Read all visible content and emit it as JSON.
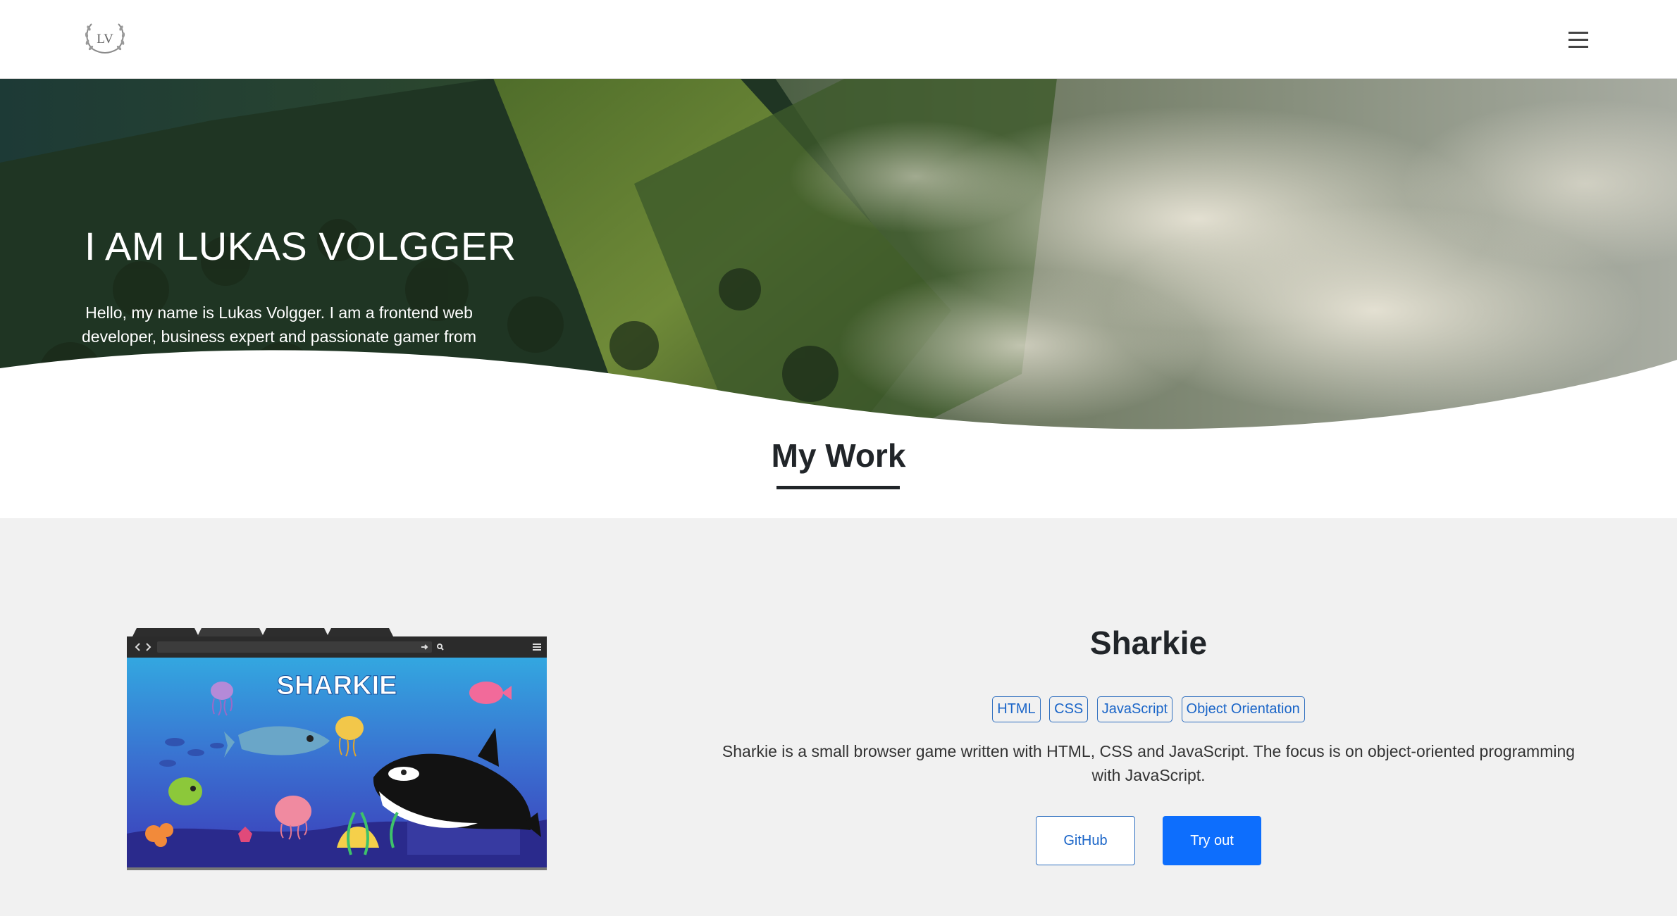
{
  "header": {
    "logo_text": "LV",
    "menu_icon": "hamburger-menu-icon"
  },
  "hero": {
    "title": "I AM LUKAS VOLGGER",
    "text": "Hello, my name is Lukas Volgger. I am a frontend web developer, business expert and passionate gamer from Austria."
  },
  "section": {
    "title": "My Work"
  },
  "project": {
    "title": "Sharkie",
    "image_text": "SHARKIE",
    "tags": [
      "HTML",
      "CSS",
      "JavaScript",
      "Object Orientation"
    ],
    "description": "Sharkie is a small browser game written with HTML, CSS and JavaScript. The focus is on object-oriented programming with JavaScript.",
    "github_label": "GitHub",
    "tryout_label": "Try out"
  },
  "colors": {
    "accent": "#0d6efd",
    "tag_border": "#2f6fbf",
    "work_bg": "#f1f1f1"
  }
}
